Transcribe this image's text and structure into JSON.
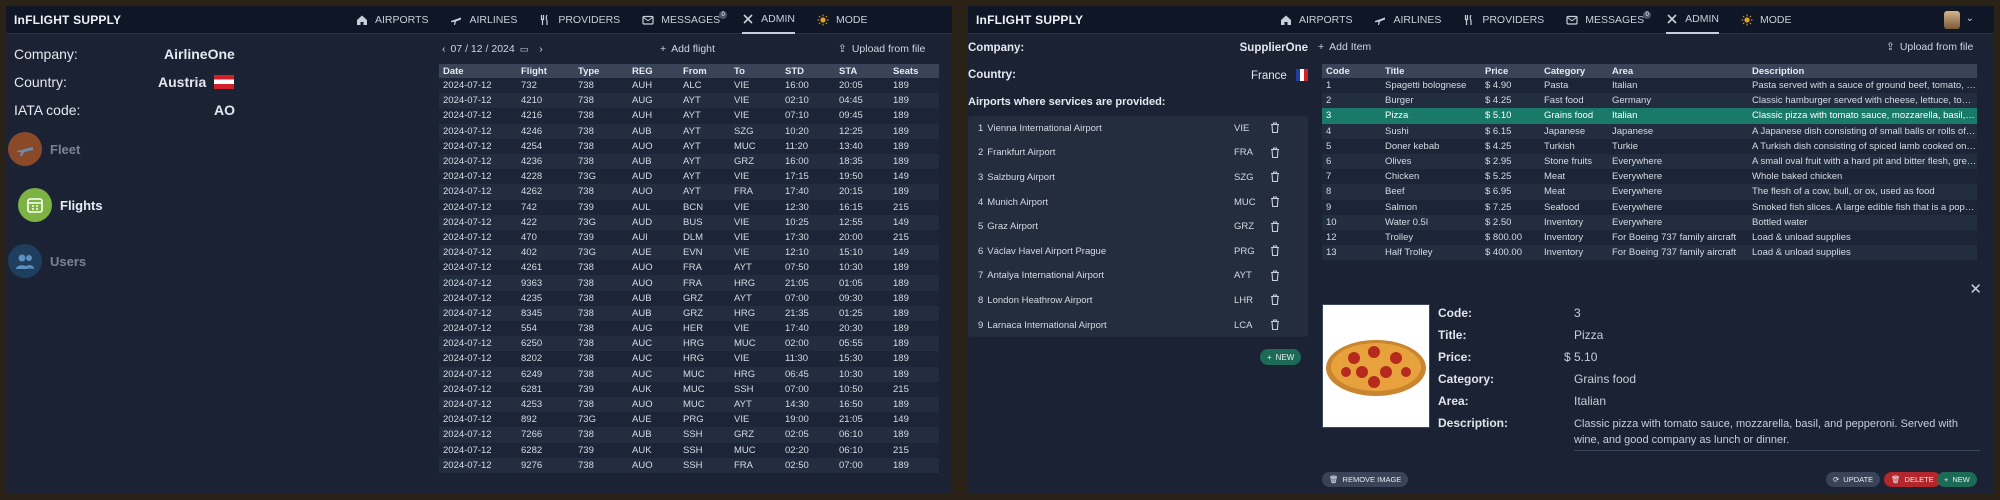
{
  "left": {
    "brand": "InFLIGHT SUPPLY",
    "nav": [
      {
        "label": "AIRPORTS",
        "icon": "home-icon"
      },
      {
        "label": "AIRLINES",
        "icon": "plane-icon"
      },
      {
        "label": "PROVIDERS",
        "icon": "cutlery-icon"
      },
      {
        "label": "MESSAGES",
        "icon": "mail-icon",
        "badge": "0"
      },
      {
        "label": "ADMIN",
        "icon": "tools-icon",
        "active": true
      },
      {
        "label": "MODE",
        "icon": "sun-icon"
      }
    ],
    "company_label": "Company:",
    "company_value": "AirlineOne",
    "country_label": "Country:",
    "country_value": "Austria",
    "iata_label": "IATA code:",
    "iata_value": "AO",
    "side": [
      {
        "label": "Fleet",
        "color": "#8a4a2a"
      },
      {
        "label": "Flights",
        "color": "#7cb342"
      },
      {
        "label": "Users",
        "color": "#2f5f8a"
      }
    ],
    "date": "07 / 12 / 2024",
    "add_flight": "Add flight",
    "upload": "Upload from file",
    "columns": [
      "Date",
      "Flight",
      "Type",
      "REG",
      "From",
      "To",
      "STD",
      "STA",
      "Seats"
    ],
    "rows": [
      [
        "2024-07-12",
        "732",
        "738",
        "AUH",
        "ALC",
        "VIE",
        "16:00",
        "20:05",
        "189"
      ],
      [
        "2024-07-12",
        "4210",
        "738",
        "AUG",
        "AYT",
        "VIE",
        "02:10",
        "04:45",
        "189"
      ],
      [
        "2024-07-12",
        "4216",
        "738",
        "AUH",
        "AYT",
        "VIE",
        "07:10",
        "09:45",
        "189"
      ],
      [
        "2024-07-12",
        "4246",
        "738",
        "AUB",
        "AYT",
        "SZG",
        "10:20",
        "12:25",
        "189"
      ],
      [
        "2024-07-12",
        "4254",
        "738",
        "AUO",
        "AYT",
        "MUC",
        "11:20",
        "13:40",
        "189"
      ],
      [
        "2024-07-12",
        "4236",
        "738",
        "AUB",
        "AYT",
        "GRZ",
        "16:00",
        "18:35",
        "189"
      ],
      [
        "2024-07-12",
        "4228",
        "73G",
        "AUD",
        "AYT",
        "VIE",
        "17:15",
        "19:50",
        "149"
      ],
      [
        "2024-07-12",
        "4262",
        "738",
        "AUO",
        "AYT",
        "FRA",
        "17:40",
        "20:15",
        "189"
      ],
      [
        "2024-07-12",
        "742",
        "739",
        "AUL",
        "BCN",
        "VIE",
        "12:30",
        "16:15",
        "215"
      ],
      [
        "2024-07-12",
        "422",
        "73G",
        "AUD",
        "BUS",
        "VIE",
        "10:25",
        "12:55",
        "149"
      ],
      [
        "2024-07-12",
        "470",
        "739",
        "AUI",
        "DLM",
        "VIE",
        "17:30",
        "20:00",
        "215"
      ],
      [
        "2024-07-12",
        "402",
        "73G",
        "AUE",
        "EVN",
        "VIE",
        "12:10",
        "15:10",
        "149"
      ],
      [
        "2024-07-12",
        "4261",
        "738",
        "AUO",
        "FRA",
        "AYT",
        "07:50",
        "10:30",
        "189"
      ],
      [
        "2024-07-12",
        "9363",
        "738",
        "AUO",
        "FRA",
        "HRG",
        "21:05",
        "01:05",
        "189"
      ],
      [
        "2024-07-12",
        "4235",
        "738",
        "AUB",
        "GRZ",
        "AYT",
        "07:00",
        "09:30",
        "189"
      ],
      [
        "2024-07-12",
        "8345",
        "738",
        "AUB",
        "GRZ",
        "HRG",
        "21:35",
        "01:25",
        "189"
      ],
      [
        "2024-07-12",
        "554",
        "738",
        "AUG",
        "HER",
        "VIE",
        "17:40",
        "20:30",
        "189"
      ],
      [
        "2024-07-12",
        "6250",
        "738",
        "AUC",
        "HRG",
        "MUC",
        "02:00",
        "05:55",
        "189"
      ],
      [
        "2024-07-12",
        "8202",
        "738",
        "AUC",
        "HRG",
        "VIE",
        "11:30",
        "15:30",
        "189"
      ],
      [
        "2024-07-12",
        "6249",
        "738",
        "AUC",
        "MUC",
        "HRG",
        "06:45",
        "10:30",
        "189"
      ],
      [
        "2024-07-12",
        "6281",
        "739",
        "AUK",
        "MUC",
        "SSH",
        "07:00",
        "10:50",
        "215"
      ],
      [
        "2024-07-12",
        "4253",
        "738",
        "AUO",
        "MUC",
        "AYT",
        "14:30",
        "16:50",
        "189"
      ],
      [
        "2024-07-12",
        "892",
        "73G",
        "AUE",
        "PRG",
        "VIE",
        "19:00",
        "21:05",
        "149"
      ],
      [
        "2024-07-12",
        "7266",
        "738",
        "AUB",
        "SSH",
        "GRZ",
        "02:05",
        "06:10",
        "189"
      ],
      [
        "2024-07-12",
        "6282",
        "739",
        "AUK",
        "SSH",
        "MUC",
        "02:20",
        "06:10",
        "215"
      ],
      [
        "2024-07-12",
        "9276",
        "738",
        "AUO",
        "SSH",
        "FRA",
        "02:50",
        "07:00",
        "189"
      ]
    ]
  },
  "right": {
    "brand": "InFLIGHT SUPPLY",
    "nav": [
      {
        "label": "AIRPORTS",
        "icon": "home-icon"
      },
      {
        "label": "AIRLINES",
        "icon": "plane-icon"
      },
      {
        "label": "PROVIDERS",
        "icon": "cutlery-icon"
      },
      {
        "label": "MESSAGES",
        "icon": "mail-icon",
        "badge": "0"
      },
      {
        "label": "ADMIN",
        "icon": "tools-icon",
        "active": true
      },
      {
        "label": "MODE",
        "icon": "sun-icon"
      }
    ],
    "company_label": "Company:",
    "company_value": "SupplierOne",
    "country_label": "Country:",
    "country_value": "France",
    "airports_title": "Airports where services are provided:",
    "airports": [
      {
        "n": "1",
        "name": "Vienna International Airport",
        "code": "VIE"
      },
      {
        "n": "2",
        "name": "Frankfurt Airport",
        "code": "FRA"
      },
      {
        "n": "3",
        "name": "Salzburg Airport",
        "code": "SZG"
      },
      {
        "n": "4",
        "name": "Munich Airport",
        "code": "MUC"
      },
      {
        "n": "5",
        "name": "Graz Airport",
        "code": "GRZ"
      },
      {
        "n": "6",
        "name": "Václav Havel Airport Prague",
        "code": "PRG"
      },
      {
        "n": "7",
        "name": "Antalya International Airport",
        "code": "AYT"
      },
      {
        "n": "8",
        "name": "London Heathrow Airport",
        "code": "LHR"
      },
      {
        "n": "9",
        "name": "Larnaca International Airport",
        "code": "LCA"
      }
    ],
    "new_label": "NEW",
    "add_item": "Add Item",
    "upload": "Upload from file",
    "columns": [
      "Code",
      "Title",
      "Price",
      "Category",
      "Area",
      "Description"
    ],
    "rows": [
      [
        "1",
        "Spagetti bolognese",
        "$ 4.90",
        "Pasta",
        "Italian",
        "Pasta served with a sauce of ground beef, tomato, oni..."
      ],
      [
        "2",
        "Burger",
        "$ 4.25",
        "Fast food",
        "Germany",
        "Classic hamburger served with cheese, lettuce, tomato..."
      ],
      [
        "3",
        "Pizza",
        "$ 5.10",
        "Grains food",
        "Italian",
        "Classic pizza with tomato sauce, mozzarella, basil, and ..."
      ],
      [
        "4",
        "Sushi",
        "$ 6.15",
        "Japanese",
        "Japanese",
        "A Japanese dish consisting of small balls or rolls of vi..."
      ],
      [
        "5",
        "Doner kebab",
        "$ 4.25",
        "Turkish",
        "Turkie",
        "A Turkish dish consisting of spiced lamb cooked on a ..."
      ],
      [
        "6",
        "Olives",
        "$ 2.95",
        "Stone fruits",
        "Everywhere",
        "A small oval fruit with a hard pit and bitter flesh, green ..."
      ],
      [
        "7",
        "Chicken",
        "$ 5.25",
        "Meat",
        "Everywhere",
        "Whole baked chicken"
      ],
      [
        "8",
        "Beef",
        "$ 6.95",
        "Meat",
        "Everywhere",
        "The flesh of a cow, bull, or ox, used as food"
      ],
      [
        "9",
        "Salmon",
        "$ 7.25",
        "Seafood",
        "Everywhere",
        "Smoked fish slices. A large edible fish that is a popular..."
      ],
      [
        "10",
        "Water 0.5l",
        "$ 2.50",
        "Inventory",
        "Everywhere",
        "Bottled water"
      ],
      [
        "12",
        "Trolley",
        "$ 800.00",
        "Inventory",
        "For Boeing 737 family aircraft",
        "Load & unload supplies"
      ],
      [
        "13",
        "Half Trolley",
        "$ 400.00",
        "Inventory",
        "For Boeing 737 family aircraft",
        "Load & unload supplies"
      ]
    ],
    "selected_row": 2,
    "detail": {
      "code_label": "Code:",
      "code": "3",
      "title_label": "Title:",
      "title": "Pizza",
      "price_label": "Price:",
      "price": "$ 5.10",
      "category_label": "Category:",
      "category": "Grains food",
      "area_label": "Area:",
      "area": "Italian",
      "desc_label": "Description:",
      "desc": "Classic pizza with tomato sauce, mozzarella, basil, and pepperoni. Served with wine, and good company as lunch or dinner."
    },
    "remove_image": "REMOVE IMAGE",
    "update": "UPDATE",
    "delete": "DELETE",
    "new": "NEW"
  }
}
